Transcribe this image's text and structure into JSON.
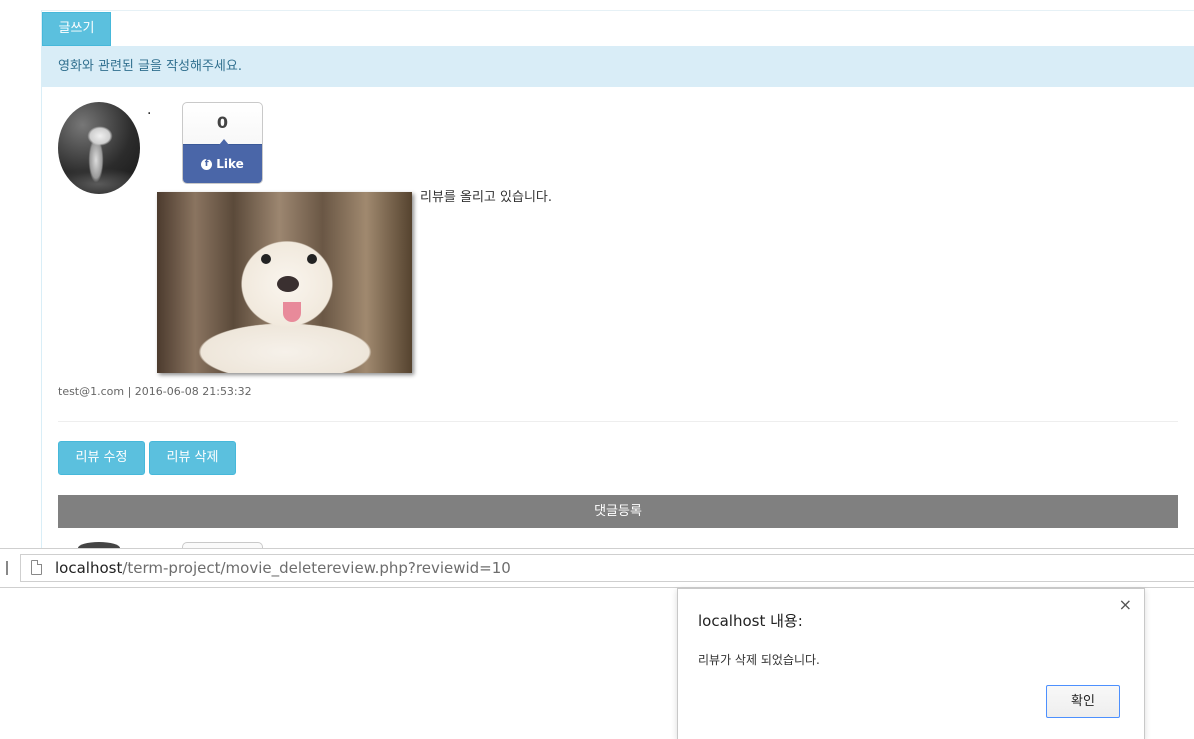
{
  "tab": {
    "label": "글쓰기"
  },
  "info": {
    "message": "영화와 관련된 글을 작성해주세요."
  },
  "review": {
    "like_count": "0",
    "like_label": "Like",
    "dot": "·",
    "text": "리뷰를 올리고 있습니다.",
    "meta": "test@1.com | 2016-06-08 21:53:32"
  },
  "actions": {
    "edit_label": "리뷰 수정",
    "delete_label": "리뷰 삭제"
  },
  "comment_bar": {
    "label": "댓글등록"
  },
  "statusbar": {
    "url_host": "localhost",
    "url_path": "/term-project/movie_deletereview.php?reviewid=10"
  },
  "dialog": {
    "title": "localhost 내용:",
    "message": "리뷰가 삭제 되었습니다.",
    "ok_label": "확인",
    "close_glyph": "×"
  }
}
